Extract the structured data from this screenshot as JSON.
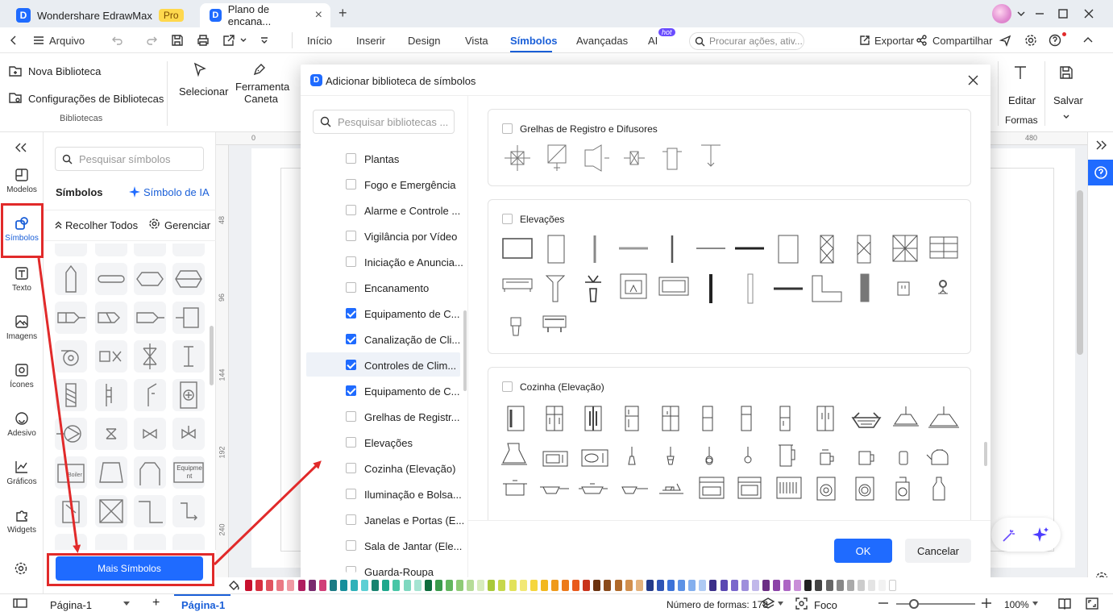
{
  "titlebar": {
    "app_tab": "Wondershare EdrawMax",
    "pro_badge": "Pro",
    "doc_tab": "Plano de encana...",
    "close": "×",
    "add": "+"
  },
  "menubar": {
    "file": "Arquivo",
    "items": [
      "Início",
      "Inserir",
      "Design",
      "Vista",
      "Símbolos",
      "Avançadas",
      "AI"
    ],
    "active": "Símbolos",
    "ai_badge": "hot",
    "search_placeholder": "Procurar ações, ativ...",
    "export": "Exportar",
    "share": "Compartilhar"
  },
  "ribbon": {
    "new_library": "Nova Biblioteca",
    "library_settings": "Configurações de Bibliotecas",
    "group_label": "Bibliotecas",
    "select": "Selecionar",
    "pen_tool_1": "Ferramenta",
    "pen_tool_2": "Caneta",
    "edit": "Editar",
    "forms": "Formas",
    "save": "Salvar"
  },
  "rail": {
    "items": [
      "Modelos",
      "Símbolos",
      "Texto",
      "Imagens",
      "Ícones",
      "Adesivo",
      "Gráficos",
      "Widgets"
    ]
  },
  "symbols_panel": {
    "search_placeholder": "Pesquisar símbolos",
    "title": "Símbolos",
    "ai_symbol": "Símbolo de IA",
    "collapse_all": "Recolher Todos",
    "manage": "Gerenciar",
    "cell_text_1": "Boiler",
    "cell_text_2": "Equipme nt",
    "more_button": "Mais Símbolos"
  },
  "ruler": {
    "top": [
      "0",
      "480"
    ],
    "left": [
      "48",
      "96",
      "144",
      "192",
      "240"
    ]
  },
  "dialog": {
    "title": "Adicionar biblioteca de símbolos",
    "search_placeholder": "Pesquisar bibliotecas ...",
    "libraries": [
      {
        "name": "Plantas",
        "checked": false
      },
      {
        "name": "Fogo e Emergência",
        "checked": false
      },
      {
        "name": "Alarme e Controle ...",
        "checked": false
      },
      {
        "name": "Vigilância por Vídeo",
        "checked": false
      },
      {
        "name": "Iniciação e Anuncia...",
        "checked": false
      },
      {
        "name": "Encanamento",
        "checked": false
      },
      {
        "name": "Equipamento de C...",
        "checked": true
      },
      {
        "name": "Canalização de Cli...",
        "checked": true
      },
      {
        "name": "Controles de Clim...",
        "checked": true
      },
      {
        "name": "Equipamento de C...",
        "checked": true
      },
      {
        "name": "Grelhas de Registr...",
        "checked": false
      },
      {
        "name": "Elevações",
        "checked": false
      },
      {
        "name": "Cozinha (Elevação)",
        "checked": false
      },
      {
        "name": "Iluminação e Bolsa...",
        "checked": false
      },
      {
        "name": "Janelas e Portas (E...",
        "checked": false
      },
      {
        "name": "Sala de Jantar (Ele...",
        "checked": false
      },
      {
        "name": "Guarda-Roupa",
        "checked": false
      }
    ],
    "groups": [
      "Grelhas de Registro e Difusores",
      "Elevações",
      "Cozinha (Elevação)"
    ],
    "ok": "OK",
    "cancel": "Cancelar"
  },
  "status": {
    "page_select": "Página-1",
    "page_tab": "Página-1",
    "shape_count": "Número de formas: 178",
    "focus": "Foco",
    "zoom": "100%",
    "add": "+"
  },
  "colors": {
    "accent": "#1f6bff",
    "annotation": "#e12a2a",
    "palette": [
      "#c8102e",
      "#d72f3f",
      "#e0545f",
      "#ea7984",
      "#f09aa3",
      "#b01d5f",
      "#7a2a6e",
      "#d03f78",
      "#1c7b85",
      "#178f9c",
      "#2fb1b9",
      "#5ccfd4",
      "#18836f",
      "#1ea78c",
      "#48c6a6",
      "#7fd8c0",
      "#a5e4d2",
      "#0d6d3d",
      "#3a9b4c",
      "#62b65e",
      "#8fcb76",
      "#b6dc98",
      "#d8ecbd",
      "#a9c93a",
      "#c7d84d",
      "#e2e25a",
      "#f2e875",
      "#f5d63d",
      "#f2b81f",
      "#ef9a1a",
      "#ec7a1b",
      "#e95a1c",
      "#c9341b",
      "#6b3310",
      "#8a4b1b",
      "#b06a2b",
      "#d18f4d",
      "#e4b27c",
      "#243b8a",
      "#2f55b5",
      "#3b72d8",
      "#5b91e6",
      "#84afee",
      "#aecaf4",
      "#3c2f8a",
      "#5a48b2",
      "#7a67cc",
      "#9e8fdc",
      "#c1b8ea",
      "#6b2d84",
      "#8c43a8",
      "#ad66c4",
      "#c98ed8",
      "#222222",
      "#444444",
      "#666666",
      "#888888",
      "#aaaaaa",
      "#cccccc",
      "#e4e4e4",
      "#f2f2f2",
      "#ffffff"
    ]
  }
}
